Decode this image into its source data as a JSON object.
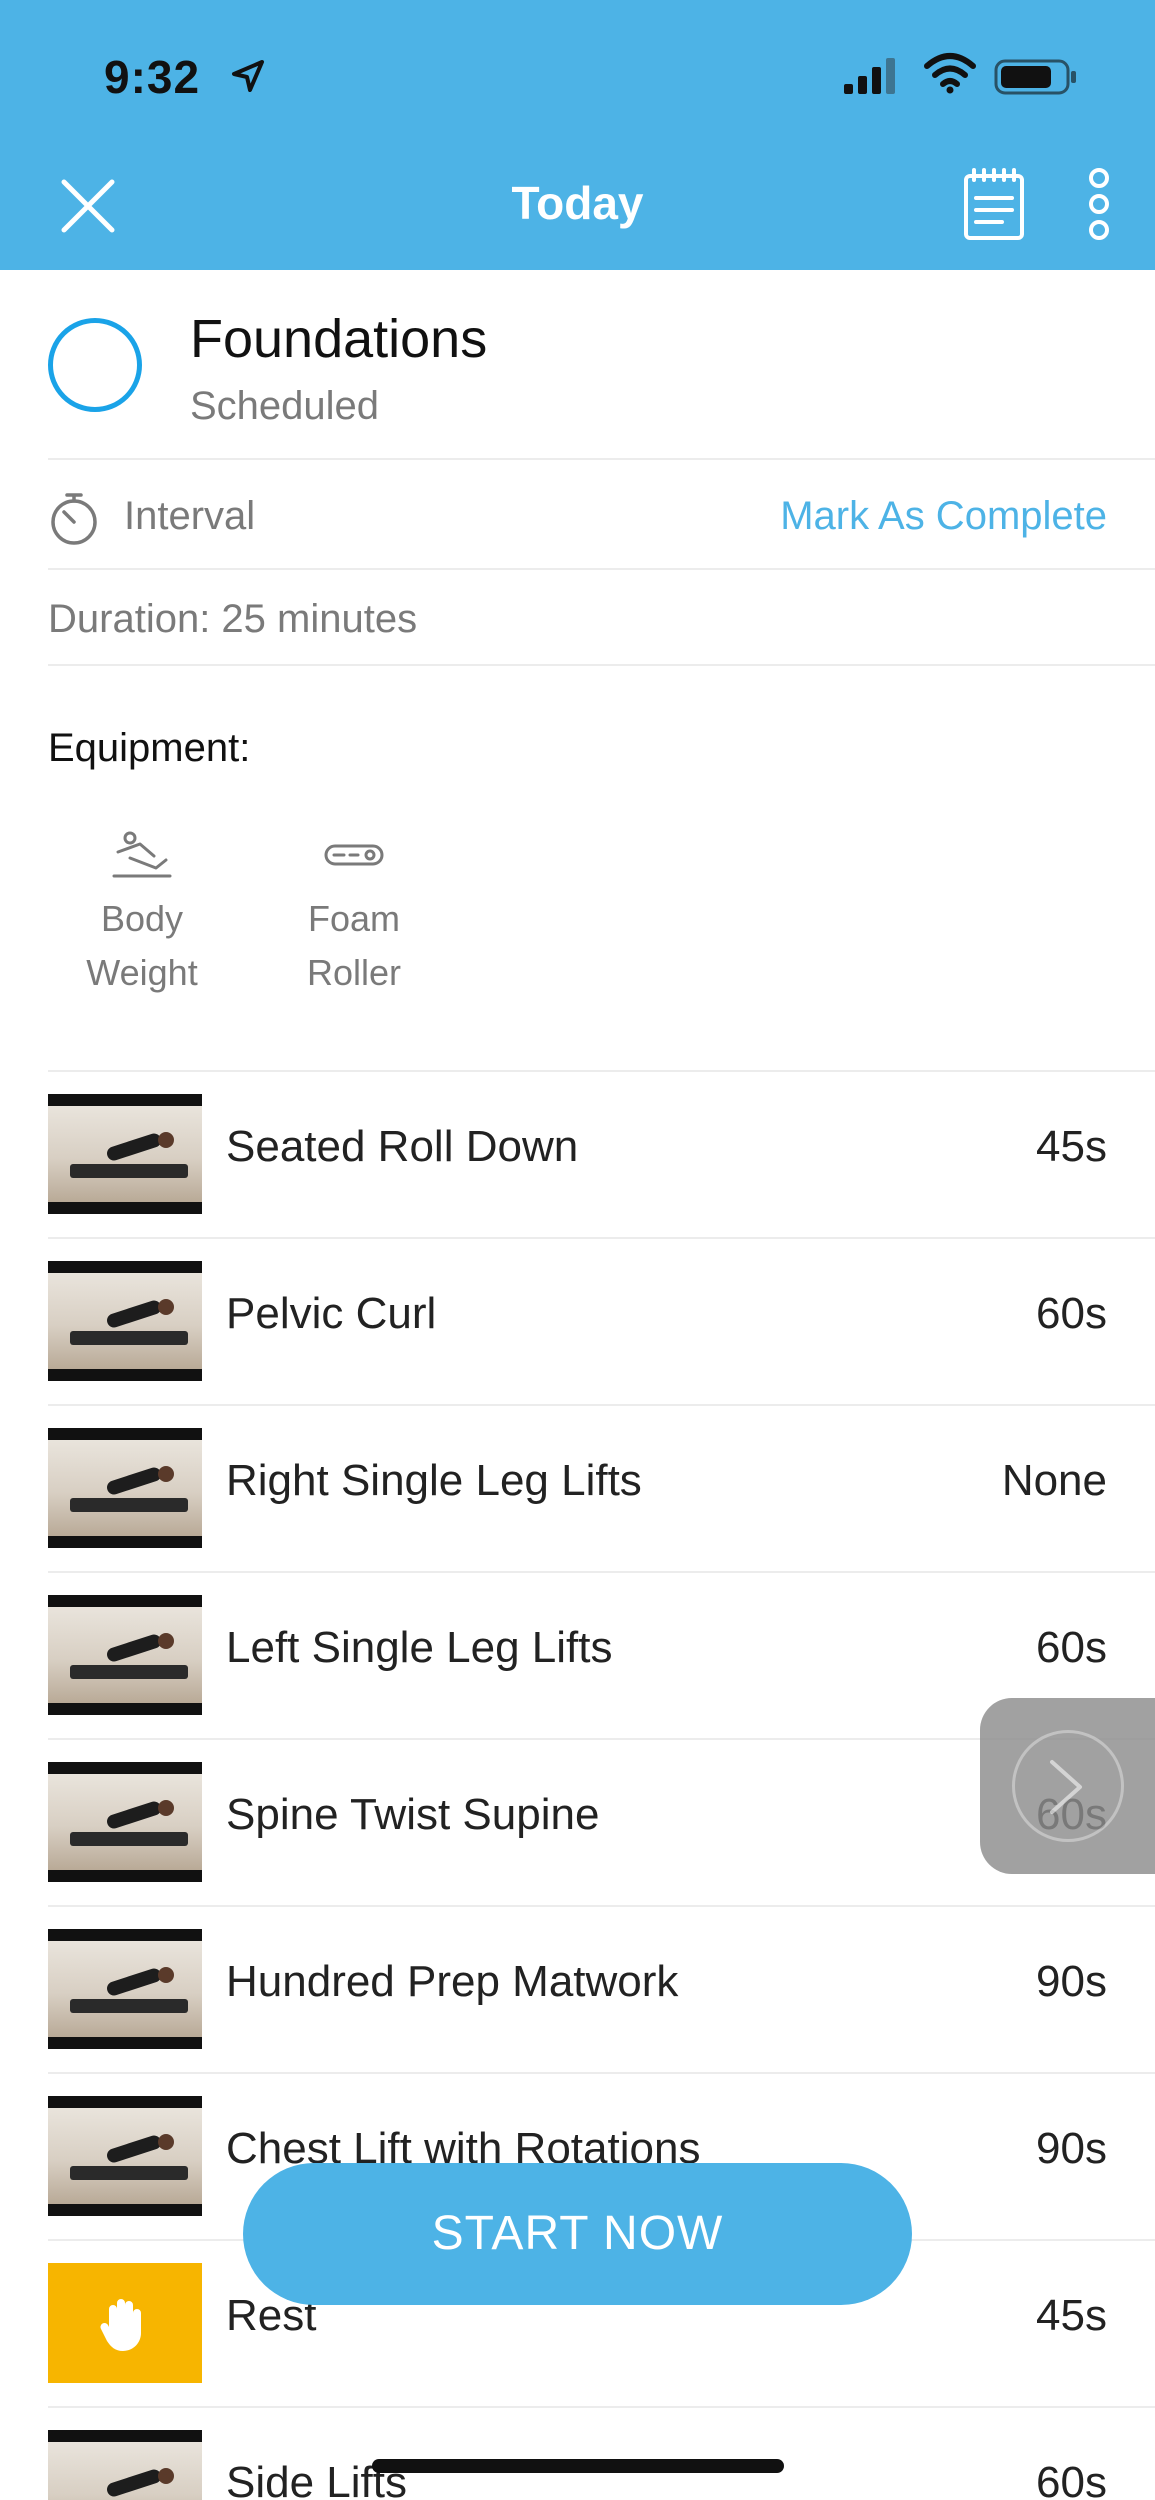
{
  "status_bar": {
    "time": "9:32"
  },
  "header": {
    "title": "Today"
  },
  "workout": {
    "name": "Foundations",
    "status": "Scheduled",
    "type": "Interval",
    "mark_complete": "Mark As Complete",
    "duration": "Duration: 25 minutes"
  },
  "equipment": {
    "title": "Equipment:",
    "items": [
      {
        "line1": "Body",
        "line2": "Weight",
        "icon": "body-weight-icon"
      },
      {
        "line1": "Foam",
        "line2": "Roller",
        "icon": "foam-roller-icon"
      }
    ]
  },
  "exercises": [
    {
      "name": "Seated Roll Down",
      "duration": "45s"
    },
    {
      "name": "Pelvic Curl",
      "duration": "60s"
    },
    {
      "name": "Right Single Leg Lifts",
      "duration": "None"
    },
    {
      "name": "Left Single Leg Lifts",
      "duration": "60s"
    },
    {
      "name": "Spine Twist Supine",
      "duration": "60s"
    },
    {
      "name": "Hundred Prep Matwork",
      "duration": "90s"
    },
    {
      "name": "Chest Lift with Rotations",
      "duration": "90s"
    },
    {
      "name": "Rest",
      "duration": "45s"
    },
    {
      "name": "Side Lifts",
      "duration": "60s"
    }
  ],
  "actions": {
    "start": "START NOW"
  },
  "colors": {
    "accent": "#4db3e6",
    "rest": "#f7b500"
  }
}
